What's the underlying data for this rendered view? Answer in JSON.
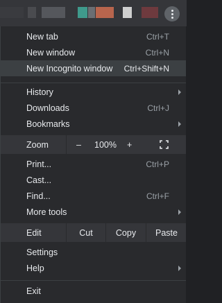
{
  "menu": {
    "new_tab": {
      "label": "New tab",
      "shortcut": "Ctrl+T"
    },
    "new_window": {
      "label": "New window",
      "shortcut": "Ctrl+N"
    },
    "new_incognito": {
      "label": "New Incognito window",
      "shortcut": "Ctrl+Shift+N"
    },
    "history": {
      "label": "History"
    },
    "downloads": {
      "label": "Downloads",
      "shortcut": "Ctrl+J"
    },
    "bookmarks": {
      "label": "Bookmarks"
    },
    "zoom": {
      "label": "Zoom",
      "minus": "–",
      "value": "100%",
      "plus": "+"
    },
    "print": {
      "label": "Print...",
      "shortcut": "Ctrl+P"
    },
    "cast": {
      "label": "Cast..."
    },
    "find": {
      "label": "Find...",
      "shortcut": "Ctrl+F"
    },
    "more_tools": {
      "label": "More tools"
    },
    "edit": {
      "label": "Edit",
      "cut": "Cut",
      "copy": "Copy",
      "paste": "Paste"
    },
    "settings": {
      "label": "Settings"
    },
    "help": {
      "label": "Help"
    },
    "exit": {
      "label": "Exit"
    }
  },
  "icons": {
    "menu_button": "more-vert-icon",
    "fullscreen": "fullscreen-icon",
    "submenu_arrow": "chevron-right-icon"
  },
  "colors": {
    "menu_bg": "#292a2d",
    "highlight": "#3c4043",
    "text": "#e8eaed",
    "shortcut_text": "#9aa0a6"
  }
}
